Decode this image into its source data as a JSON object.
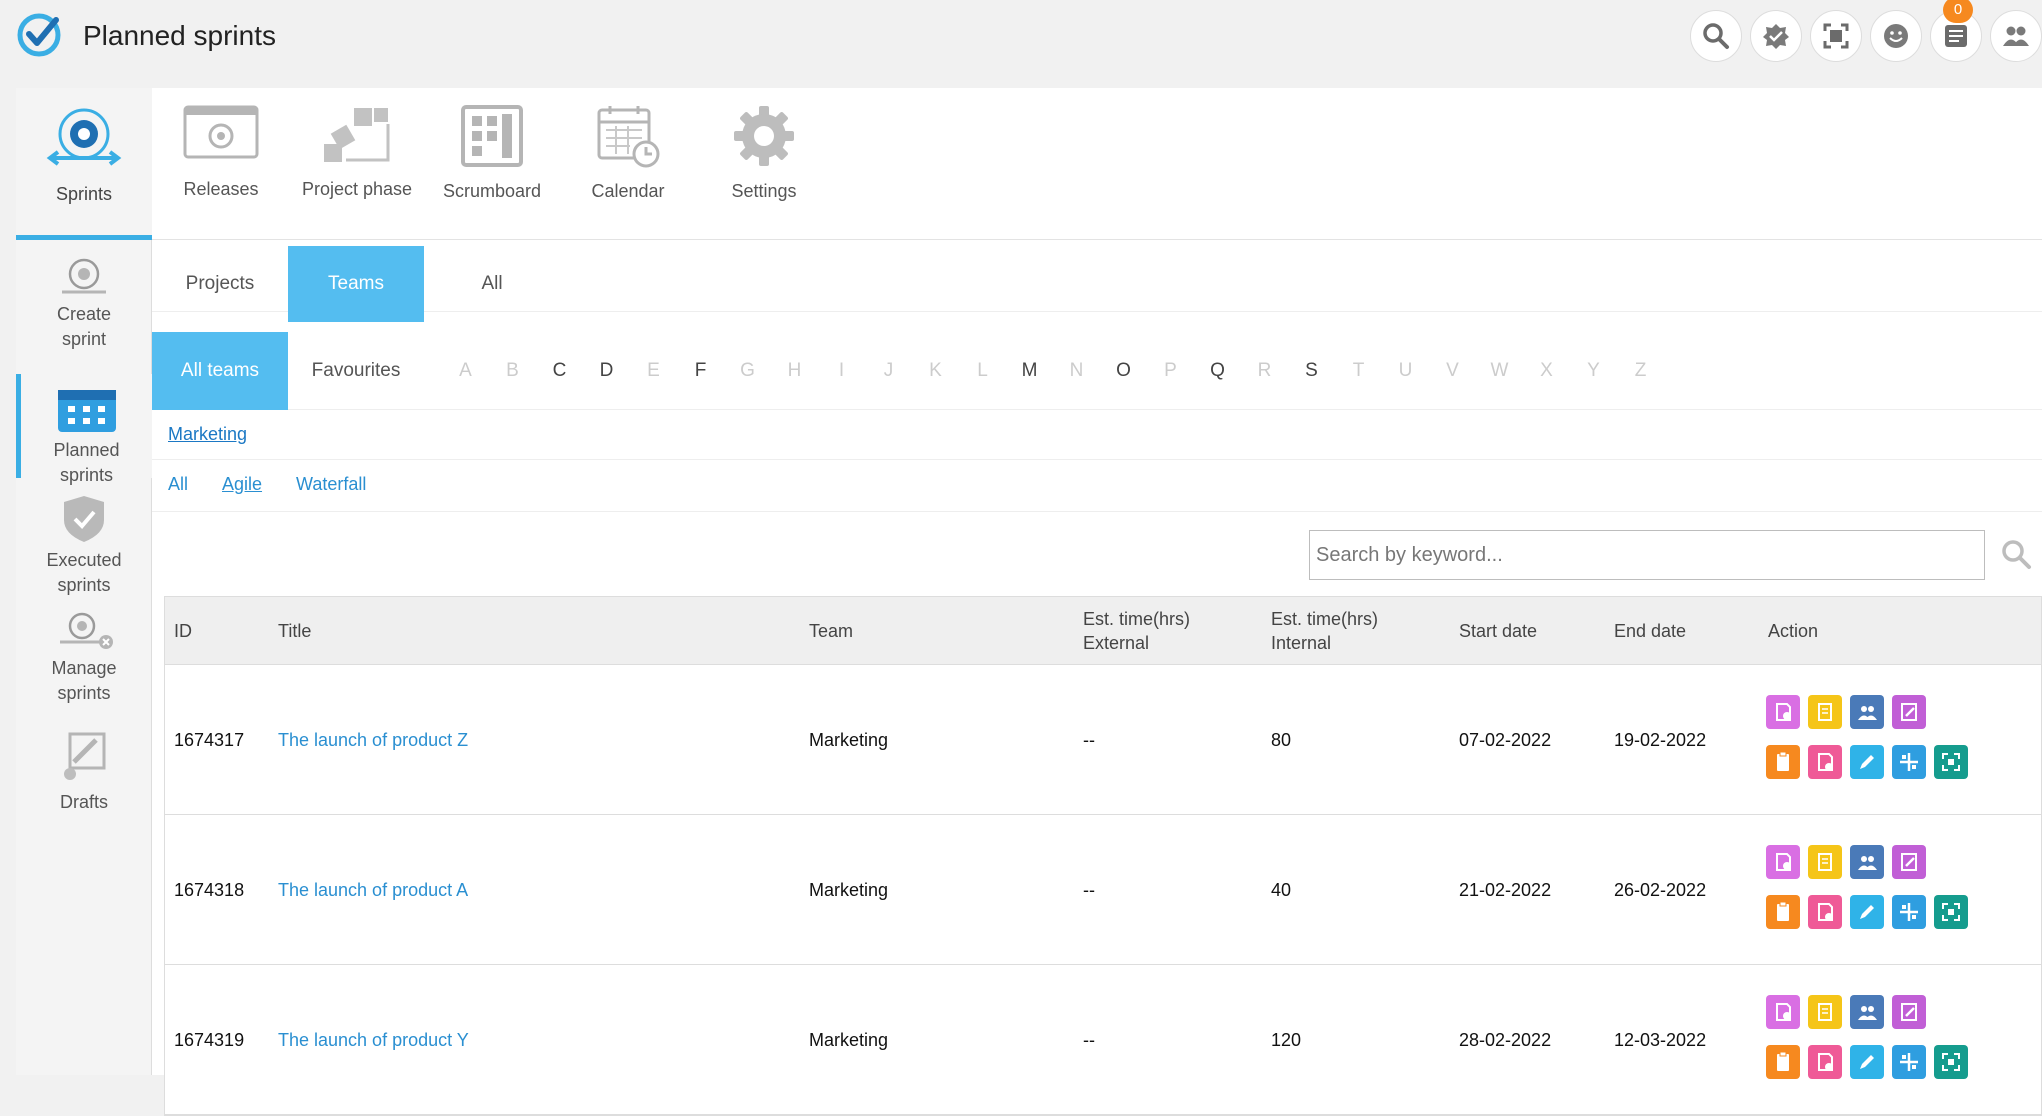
{
  "header": {
    "title": "Planned sprints",
    "notification_count": "0",
    "icons": [
      "search-icon",
      "check-badge-icon",
      "screen-capture-icon",
      "smiley-icon",
      "notes-icon",
      "users-icon"
    ]
  },
  "sidebar": {
    "main_label": "Sprints",
    "items": [
      {
        "label_line1": "Create",
        "label_line2": "sprint",
        "icon": "create-sprint-icon"
      },
      {
        "label_line1": "Planned",
        "label_line2": "sprints",
        "icon": "calendar-icon",
        "active": true
      },
      {
        "label_line1": "Executed",
        "label_line2": "sprints",
        "icon": "shield-check-icon"
      },
      {
        "label_line1": "Manage",
        "label_line2": "sprints",
        "icon": "manage-sprint-icon"
      },
      {
        "label_line1": "Drafts",
        "label_line2": "",
        "icon": "drafts-icon"
      }
    ]
  },
  "toolbar": {
    "items": [
      {
        "label": "Releases",
        "icon": "releases-icon"
      },
      {
        "label": "Project phase",
        "icon": "project-phase-icon"
      },
      {
        "label": "Scrumboard",
        "icon": "scrumboard-icon"
      },
      {
        "label": "Calendar",
        "icon": "calendar-icon"
      },
      {
        "label": "Settings",
        "icon": "gear-icon"
      }
    ]
  },
  "tabs": [
    {
      "label": "Projects"
    },
    {
      "label": "Teams",
      "active": true
    },
    {
      "label": "All"
    }
  ],
  "filters": {
    "all_teams": "All teams",
    "favourites": "Favourites",
    "letters": [
      "A",
      "B",
      "C",
      "D",
      "E",
      "F",
      "G",
      "H",
      "I",
      "J",
      "K",
      "L",
      "M",
      "N",
      "O",
      "P",
      "Q",
      "R",
      "S",
      "T",
      "U",
      "V",
      "W",
      "X",
      "Y",
      "Z"
    ],
    "enabled_letters": [
      "C",
      "D",
      "F",
      "M",
      "O",
      "Q",
      "S"
    ]
  },
  "breadcrumb": {
    "team": "Marketing"
  },
  "methods": {
    "all": "All",
    "agile": "Agile",
    "waterfall": "Waterfall"
  },
  "search": {
    "placeholder": "Search by keyword..."
  },
  "table": {
    "headers": {
      "id": "ID",
      "title": "Title",
      "team": "Team",
      "est_ext_1": "Est. time(hrs)",
      "est_ext_2": "External",
      "est_int_1": "Est. time(hrs)",
      "est_int_2": "Internal",
      "start": "Start date",
      "end": "End date",
      "action": "Action"
    },
    "rows": [
      {
        "id": "1674317",
        "title": "The launch of product Z",
        "team": "Marketing",
        "external": "--",
        "internal": "80",
        "start": "07-02-2022",
        "end": "19-02-2022"
      },
      {
        "id": "1674318",
        "title": "The launch of product A",
        "team": "Marketing",
        "external": "--",
        "internal": "40",
        "start": "21-02-2022",
        "end": "26-02-2022"
      },
      {
        "id": "1674319",
        "title": "The launch of product Y",
        "team": "Marketing",
        "external": "--",
        "internal": "120",
        "start": "28-02-2022",
        "end": "12-03-2022"
      }
    ],
    "action_colors": [
      "#d96fe3",
      "#f5c518",
      "#4a7ab8",
      "#c15fd6",
      "#f6891f",
      "#ef5a97",
      "#2fb3e8",
      "#2f9ee0",
      "#159c8e"
    ]
  }
}
